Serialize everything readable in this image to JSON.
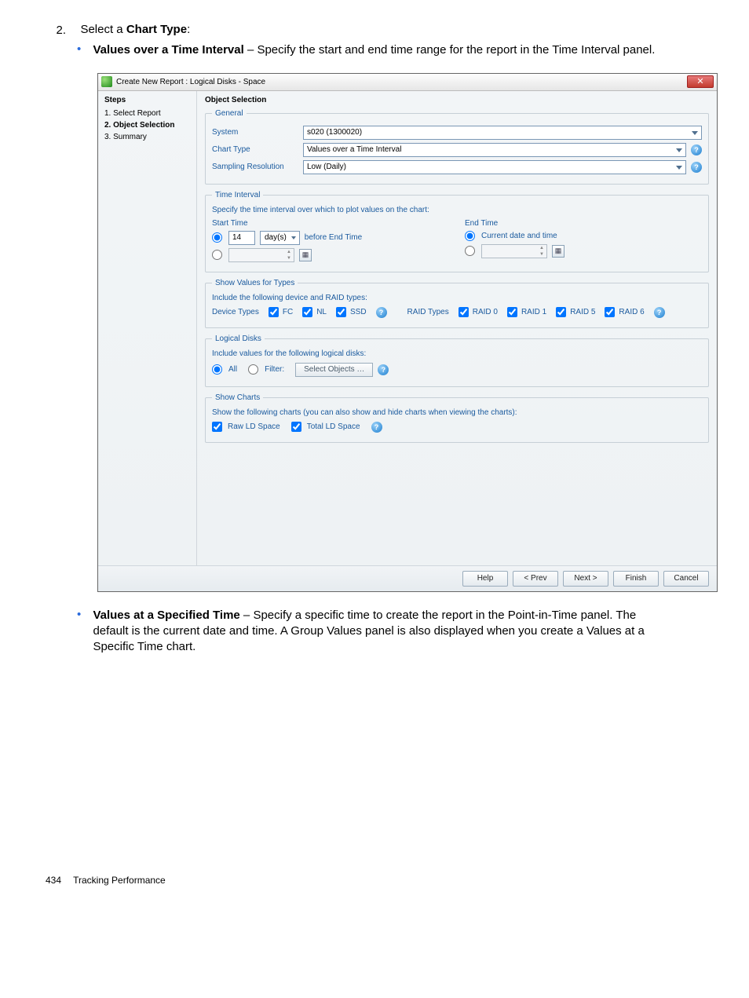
{
  "doc": {
    "step_number": "2.",
    "step_text_prefix": "Select a ",
    "step_text_bold": "Chart Type",
    "step_text_suffix": ":",
    "bullet1_bold": "Values over a Time Interval",
    "bullet1_rest": " – Specify the start and end time range for the report in the Time Interval panel.",
    "bullet2_bold": "Values at a Specified Time",
    "bullet2_rest": " – Specify a specific time to create the report in the Point-in-Time panel. The default is the current date and time. A Group Values panel is also displayed when you create a Values at a Specific Time chart.",
    "footer_page": "434",
    "footer_section": "Tracking Performance"
  },
  "dialog": {
    "title": "Create New Report : Logical Disks - Space",
    "close_glyph": "✕",
    "steps_header": "Steps",
    "steps": [
      "1. Select Report",
      "2. Object Selection",
      "3. Summary"
    ],
    "main_header": "Object Selection",
    "general": {
      "legend": "General",
      "system_label": "System",
      "system_value": "s020 (1300020)",
      "charttype_label": "Chart Type",
      "charttype_value": "Values over a Time Interval",
      "sampling_label": "Sampling Resolution",
      "sampling_value": "Low (Daily)"
    },
    "time_interval": {
      "legend": "Time Interval",
      "desc": "Specify the time interval over which to plot values on the chart:",
      "start_label": "Start Time",
      "end_label": "End Time",
      "days_value": "14",
      "days_unit": "day(s)",
      "before_end": "before End Time",
      "current": "Current date and time"
    },
    "types": {
      "legend": "Show Values for Types",
      "desc": "Include the following device and RAID types:",
      "device_label": "Device Types",
      "devices": [
        "FC",
        "NL",
        "SSD"
      ],
      "raid_label": "RAID Types",
      "raids": [
        "RAID 0",
        "RAID 1",
        "RAID 5",
        "RAID 6"
      ]
    },
    "logical": {
      "legend": "Logical Disks",
      "desc": "Include values for the following logical disks:",
      "all": "All",
      "filter": "Filter:",
      "select_btn": "Select Objects …"
    },
    "charts": {
      "legend": "Show Charts",
      "desc": "Show the following charts (you can also show and hide charts when viewing the charts):",
      "opts": [
        "Raw LD Space",
        "Total LD Space"
      ]
    },
    "buttons": {
      "help": "Help",
      "prev": "< Prev",
      "next": "Next >",
      "finish": "Finish",
      "cancel": "Cancel"
    },
    "help_glyph": "?",
    "cal_glyph": "▦"
  }
}
